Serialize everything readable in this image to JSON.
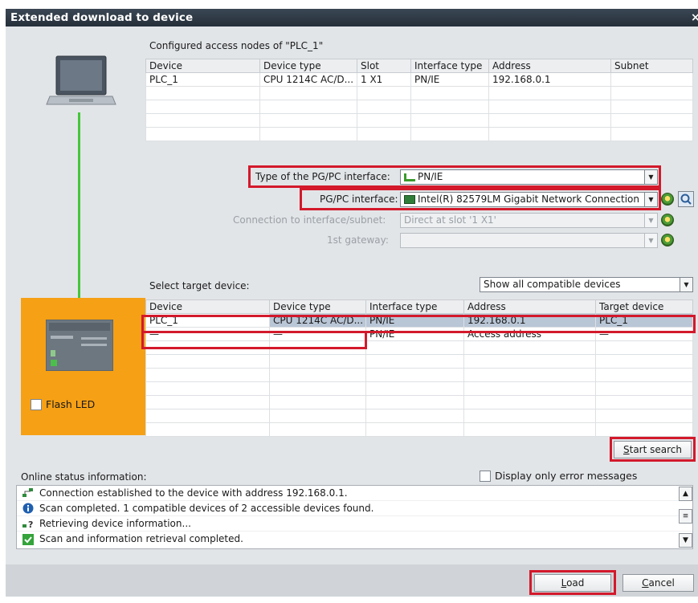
{
  "window": {
    "title": "Extended download to device",
    "close_glyph": "×"
  },
  "configured": {
    "heading": "Configured access nodes of \"PLC_1\"",
    "columns": [
      "Device",
      "Device type",
      "Slot",
      "Interface type",
      "Address",
      "Subnet"
    ],
    "rows": [
      [
        "PLC_1",
        "CPU 1214C AC/D...",
        "1 X1",
        "PN/IE",
        "192.168.0.1",
        ""
      ]
    ]
  },
  "interface": {
    "type_label": "Type of the PG/PC interface:",
    "type_value": "PN/IE",
    "pgpc_label": "PG/PC interface:",
    "pgpc_value": "Intel(R) 82579LM Gigabit Network Connection",
    "connection_label": "Connection to interface/subnet:",
    "connection_value": "Direct at slot '1 X1'",
    "gateway_label": "1st gateway:",
    "gateway_value": ""
  },
  "target": {
    "heading": "Select target device:",
    "filter_value": "Show all compatible devices",
    "columns": [
      "Device",
      "Device type",
      "Interface type",
      "Address",
      "Target device"
    ],
    "rows": [
      [
        "PLC_1",
        "CPU 1214C AC/D...",
        "PN/IE",
        "192.168.0.1",
        "PLC_1"
      ],
      [
        "—",
        "—",
        "PN/IE",
        "Access address",
        "—"
      ]
    ]
  },
  "flash_led_label": "Flash LED",
  "start_search": {
    "mnemonic": "S",
    "rest": "tart search"
  },
  "status": {
    "heading": "Online status information:",
    "error_only_label": "Display only error messages",
    "messages": [
      "Connection established to the device with address 192.168.0.1.",
      "Scan completed. 1 compatible devices of 2 accessible devices found.",
      "Retrieving device information...",
      "Scan and information retrieval completed."
    ]
  },
  "buttons": {
    "load": {
      "mnemonic": "L",
      "rest": "oad"
    },
    "cancel": {
      "mnemonic": "C",
      "rest": "ancel"
    }
  },
  "colors": {
    "title_bar": "#2b3540",
    "dialog_bg": "#e2e5e8",
    "highlight_red": "#d3192b",
    "device_panel": "#f6a015",
    "connection_line": "#44c63a",
    "selected_row": "#b9c6d6"
  },
  "icons": {
    "laptop": "laptop-icon",
    "plc": "plc-device-icon",
    "pnie": "pn-ie-network-icon",
    "nic": "network-card-icon",
    "shield": "shield-status-icon",
    "search": "find-device-icon",
    "connection": "connection-icon",
    "info": "info-icon",
    "retrieve": "retrieve-info-icon",
    "success": "check-success-icon"
  }
}
